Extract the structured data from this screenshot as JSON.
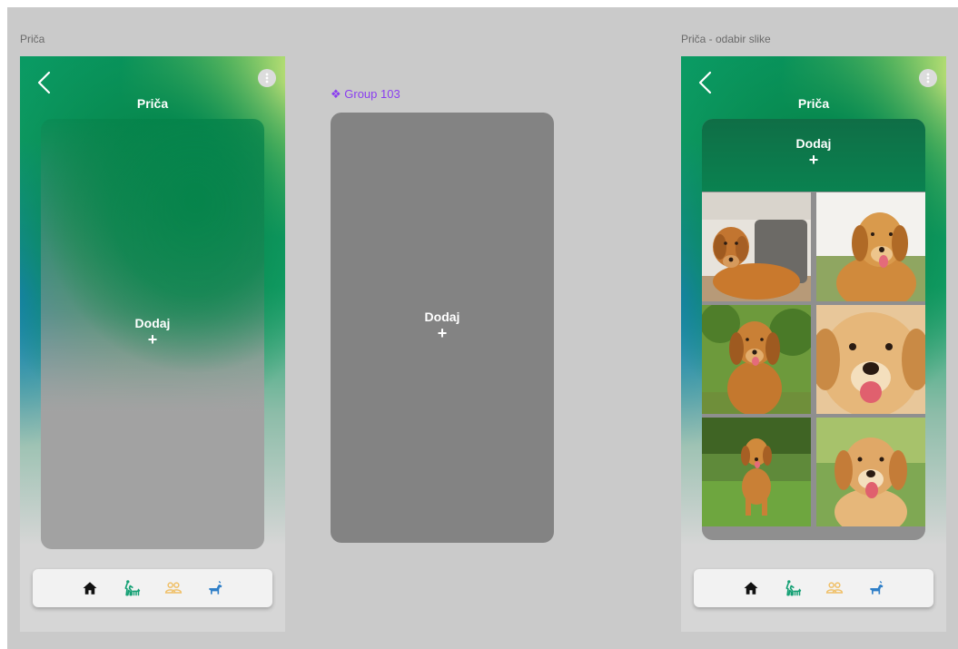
{
  "frames": {
    "left_label": "Priča",
    "right_label": "Priča - odabir slike",
    "group_label": "❖ Group 103"
  },
  "screen1": {
    "title": "Priča",
    "add_label": "Dodaj",
    "add_plus": "+"
  },
  "group": {
    "add_label": "Dodaj",
    "add_plus": "+"
  },
  "screen2": {
    "title": "Priča",
    "add_label": "Dodaj",
    "add_plus": "+",
    "photos": [
      "golden-retriever-on-sofa",
      "golden-retriever-in-field",
      "golden-retriever-in-garden",
      "golden-retriever-closeup",
      "golden-retriever-on-lawn",
      "golden-retriever-puppy-smiling"
    ]
  },
  "nav": {
    "items": [
      {
        "icon": "home-icon",
        "color": "#111111"
      },
      {
        "icon": "dog-walk-icon",
        "color": "#14a074"
      },
      {
        "icon": "friends-icon",
        "color": "#f0c068"
      },
      {
        "icon": "dog-icon",
        "color": "#2f7fc8"
      }
    ]
  },
  "colors": {
    "canvas": "#cacaca",
    "accent_green": "#04844a",
    "group_label": "#8a3df0",
    "group_card": "#838383"
  }
}
